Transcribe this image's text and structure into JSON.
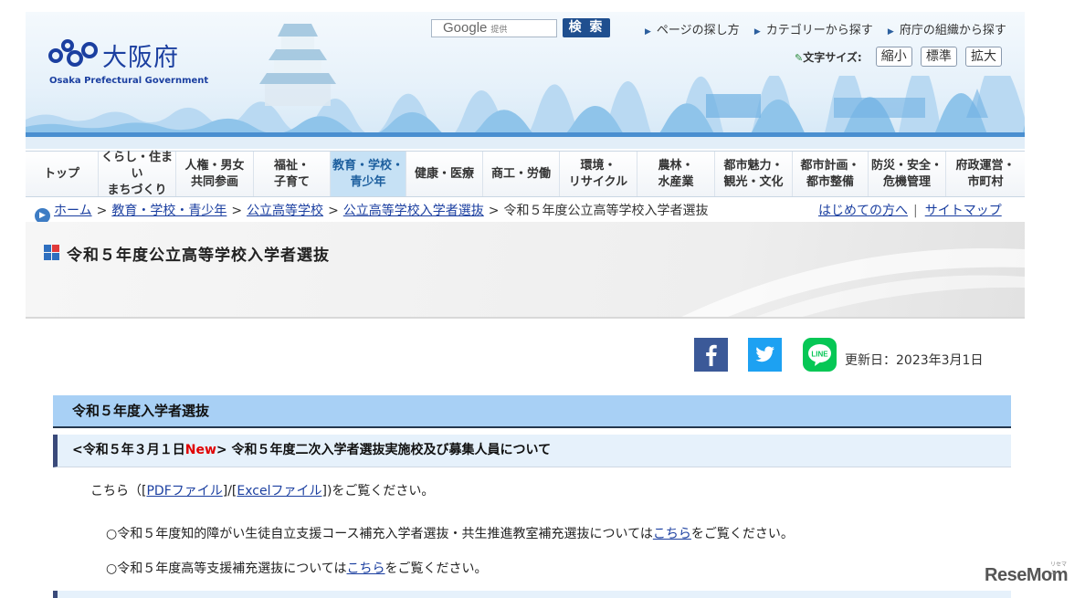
{
  "header": {
    "logo_text": "大阪府",
    "logo_subtitle": "Osaka Prefectural Government",
    "search_brand": "Google",
    "search_provided": "提供",
    "search_button": "検 索",
    "top_links": [
      "ページの探し方",
      "カテゴリーから探す",
      "府庁の組織から探す"
    ],
    "font_size_label": "文字サイズ:",
    "font_size_buttons": [
      "縮小",
      "標準",
      "拡大"
    ]
  },
  "nav": {
    "items": [
      "トップ",
      "くらし・住まい\nまちづくり",
      "人権・男女\n共同参画",
      "福祉・\n子育て",
      "教育・学校・\n青少年",
      "健康・医療",
      "商工・労働",
      "環境・\nリサイクル",
      "農林・\n水産業",
      "都市魅力・\n観光・文化",
      "都市計画・\n都市整備",
      "防災・安全・\n危機管理",
      "府政運営・\n市町村"
    ],
    "active_index": 4
  },
  "breadcrumb": {
    "items": [
      "ホーム",
      "教育・学校・青少年",
      "公立高等学校",
      "公立高等学校入学者選抜"
    ],
    "current": "令和５年度公立高等学校入学者選抜",
    "separator": ">"
  },
  "utility": {
    "first_visit": "はじめての方へ",
    "divider": "|",
    "sitemap": "サイトマップ"
  },
  "page": {
    "title": "令和５年度公立高等学校入学者選抜",
    "updated": "更新日：2023年3月1日"
  },
  "content": {
    "section_title": "令和５年度入学者選抜",
    "subsection": {
      "prefix": "<令和５年３月１日",
      "new_label": "New",
      "suffix": "> 令和５年度二次入学者選抜実施校及び募集人員について"
    },
    "para1": {
      "before": "こちら（[",
      "pdf_link": "PDFファイル",
      "middle": "]/[",
      "excel_link": "Excelファイル",
      "after": "])をご覧ください。"
    },
    "para2": {
      "before": "○令和５年度知的障がい生徒自立支援コース補充入学者選抜・共生推進教室補充選抜については",
      "link": "こちら",
      "after": "をご覧ください。"
    },
    "para3": {
      "before": "○令和５年度高等支援補充選抜については",
      "link": "こちら",
      "after": "をご覧ください。"
    }
  },
  "watermark": {
    "text": "ReseMom",
    "kana": "リセマム"
  },
  "colors": {
    "brand_blue": "#1b3fa0",
    "nav_active": "#c6e1f5",
    "new_red": "#e00000",
    "section_bg": "#a8d0f5"
  }
}
